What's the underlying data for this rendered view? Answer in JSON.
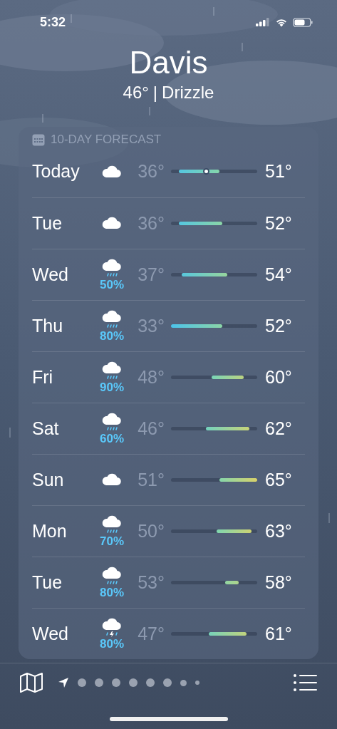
{
  "status_bar": {
    "time": "5:32"
  },
  "location": {
    "city": "Davis",
    "current_temp": "46°",
    "separator": "|",
    "condition": "Drizzle"
  },
  "forecast": {
    "title": "10-DAY FORECAST",
    "days": [
      {
        "day": "Today",
        "kind": "cloud",
        "low": "36°",
        "high": "51°",
        "current": true
      },
      {
        "day": "Tue",
        "kind": "cloud",
        "low": "36°",
        "high": "52°",
        "current": false
      },
      {
        "day": "Wed",
        "kind": "rain",
        "precip": "50%",
        "low": "37°",
        "high": "54°",
        "current": false
      },
      {
        "day": "Thu",
        "kind": "rain",
        "precip": "80%",
        "low": "33°",
        "high": "52°",
        "current": false
      },
      {
        "day": "Fri",
        "kind": "rain",
        "precip": "90%",
        "low": "48°",
        "high": "60°",
        "current": false
      },
      {
        "day": "Sat",
        "kind": "rain",
        "precip": "60%",
        "low": "46°",
        "high": "62°",
        "current": false
      },
      {
        "day": "Sun",
        "kind": "cloud",
        "low": "51°",
        "high": "65°",
        "current": false
      },
      {
        "day": "Mon",
        "kind": "rain",
        "precip": "70%",
        "low": "50°",
        "high": "63°",
        "current": false
      },
      {
        "day": "Tue",
        "kind": "rain",
        "precip": "80%",
        "low": "53°",
        "high": "58°",
        "current": false
      },
      {
        "day": "Wed",
        "kind": "thunder",
        "precip": "80%",
        "low": "47°",
        "high": "61°",
        "current": false
      }
    ]
  },
  "pages": [
    {
      "kind": "location",
      "selected": true
    },
    {
      "kind": "dot",
      "selected": false
    },
    {
      "kind": "dot",
      "selected": false
    },
    {
      "kind": "dot",
      "selected": false
    },
    {
      "kind": "dot",
      "selected": false
    },
    {
      "kind": "dot",
      "selected": false
    },
    {
      "kind": "dot",
      "selected": false
    },
    {
      "kind": "small",
      "selected": false
    },
    {
      "kind": "tiny",
      "selected": false
    }
  ]
}
